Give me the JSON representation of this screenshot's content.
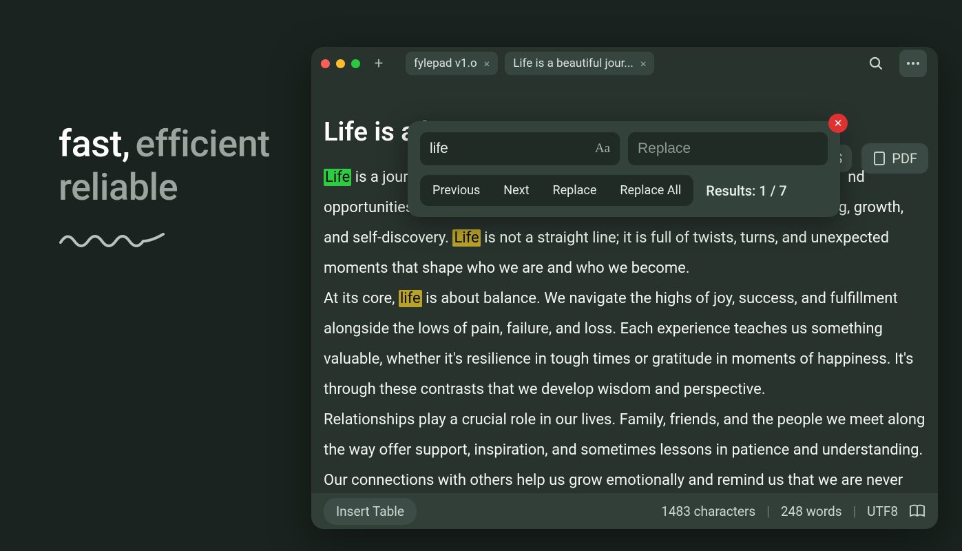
{
  "hero": {
    "word1": "fast",
    "comma": ",",
    "word2": "efficient",
    "line2": "reliable"
  },
  "window": {
    "tabs": [
      {
        "label": "fylepad v1.o"
      },
      {
        "label": "Life is a beautiful jour..."
      }
    ],
    "actions": {
      "s_label": "S",
      "pdf_label": "PDF"
    }
  },
  "findReplace": {
    "search_value": "life",
    "replace_placeholder": "Replace",
    "buttons": {
      "previous": "Previous",
      "next": "Next",
      "replace": "Replace",
      "replaceAll": "Replace All"
    },
    "results_label": "Results: 1 / 7",
    "current": 1,
    "total": 7
  },
  "document": {
    "title_visible": "Life is a b",
    "body": {
      "p1_seg1": "Life",
      "p1_seg2": " is a jour",
      "p1_tail": "nd opportunities. From the moment we are born, we embark on a path of learning, growth, and self-discovery. ",
      "p1_hl2": "Life",
      "p1_seg3": " is not a straight line; it is full of twists, turns, and unexpected moments that shape who we are and who we become.",
      "p2_pre": "At its core, ",
      "p2_hl": "life",
      "p2_rest": " is about balance. We navigate the highs of joy, success, and fulfillment alongside the lows of pain, failure, and loss. Each experience teaches us something valuable, whether it's resilience in tough times or gratitude in moments of happiness. It's through these contrasts that we develop wisdom and perspective.",
      "p3": "Relationships play a crucial role in our lives. Family, friends, and the people we meet along the way offer support, inspiration, and sometimes lessons in patience and understanding. Our connections with others help us grow emotionally and remind us that we are never truly alone in our journey"
    }
  },
  "status": {
    "insert_table": "Insert Table",
    "chars": "1483 characters",
    "words": "248 words",
    "encoding": "UTF8"
  },
  "colors": {
    "highlight_active": "#2ecc40",
    "highlight": "#b9a22a",
    "bg": "#1a231f",
    "panel": "#33423b"
  }
}
